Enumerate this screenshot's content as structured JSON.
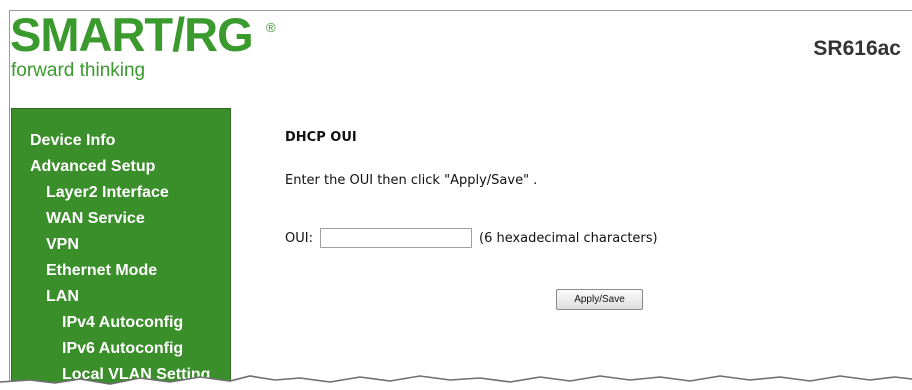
{
  "header": {
    "brand": "SMART/RG",
    "registered_mark": "®",
    "tagline": "forward thinking",
    "model": "SR616ac",
    "brand_color": "#3a9a2e"
  },
  "sidebar": {
    "background_color": "#3b8f2b",
    "items": [
      {
        "label": "Device Info"
      },
      {
        "label": "Advanced Setup"
      },
      {
        "label": "Layer2 Interface"
      },
      {
        "label": "WAN Service"
      },
      {
        "label": "VPN"
      },
      {
        "label": "Ethernet Mode"
      },
      {
        "label": "LAN"
      },
      {
        "label": "IPv4 Autoconfig"
      },
      {
        "label": "IPv6 Autoconfig"
      },
      {
        "label": "Local VLAN Setting"
      }
    ]
  },
  "main": {
    "title": "DHCP OUI",
    "instruction": "Enter the OUI then click \"Apply/Save\" .",
    "oui_label": "OUI:",
    "oui_value": "",
    "oui_hint": "(6 hexadecimal characters)",
    "apply_label": "Apply/Save"
  }
}
